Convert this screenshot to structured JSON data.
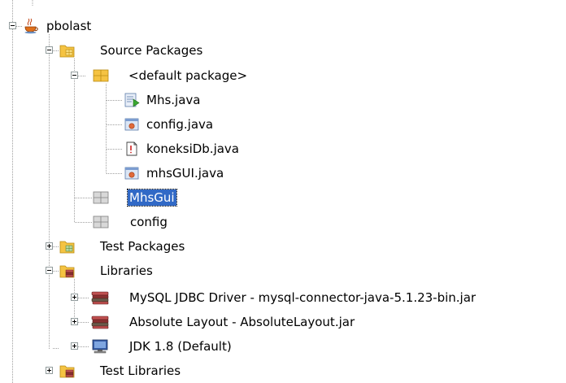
{
  "tree": {
    "project": {
      "label": "pbolast"
    },
    "source_packages": {
      "label": "Source Packages"
    },
    "default_package": {
      "label": "<default package>"
    },
    "files": [
      {
        "label": "Mhs.java"
      },
      {
        "label": "config.java"
      },
      {
        "label": "koneksiDb.java"
      },
      {
        "label": "mhsGUI.java"
      }
    ],
    "packages": [
      {
        "label": "MhsGui",
        "selected": true
      },
      {
        "label": "config"
      }
    ],
    "test_packages": {
      "label": "Test Packages"
    },
    "libraries": {
      "label": "Libraries"
    },
    "library_items": [
      {
        "label": "MySQL JDBC Driver - mysql-connector-java-5.1.23-bin.jar"
      },
      {
        "label": "Absolute Layout - AbsoluteLayout.jar"
      },
      {
        "label": "JDK 1.8 (Default)"
      }
    ],
    "test_libraries": {
      "label": "Test Libraries"
    }
  },
  "colors": {
    "selection": "#3169c6",
    "folder_yellow": "#f5c342",
    "tree_line": "#a0a0a0"
  }
}
